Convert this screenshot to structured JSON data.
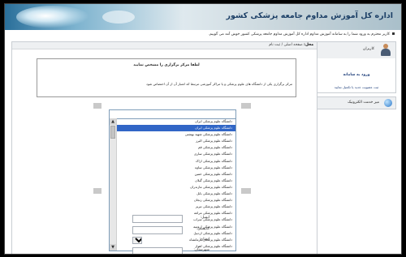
{
  "banner": {
    "title": "اداره کل آموزش مداوم جامعه پزشکی کشور"
  },
  "welcome": {
    "text": "کاربر محترم به ورود شما را به سامانه آموزش مداوم اداره کل آموزش مداوم جامعه پزشکی کشور خوش آمد می گوییم."
  },
  "page": {
    "label": "محل:",
    "path": "صفحه اصلی / ثبت نام"
  },
  "notice": {
    "title": "لطفا مرکز برگزاری را مشخص نمایید",
    "text": "مرکز برگزاری یکی از دانشگاه های علوم پزشکی و یا مراکز آموزشی مرتبط که اعتبار آن از آن اختصاص شود"
  },
  "dropdown": {
    "selected": "",
    "highlighted_index": 1,
    "options": [
      "دانشگاه علوم پزشکی ایران",
      "دانشگاه علوم پزشکی ایران",
      "دانشگاه علوم پزشکی شهید بهشتی",
      "دانشگاه علوم پزشکی البرز",
      "دانشگاه علوم پزشکی قم",
      "دانشگاه علوم پزشکی ساری",
      "دانشگاه علوم پزشکی اراک",
      "دانشگاه علوم پزشکی ساوه",
      "دانشگاه علوم پزشکی خمین",
      "دانشگاه علوم پزشکی گیلان",
      "دانشگاه علوم پزشکی مازندران",
      "دانشگاه علوم پزشکی بابل",
      "دانشگاه علوم پزشکی زنجان",
      "دانشگاه علوم پزشکی تبریز",
      "دانشگاه علوم پزشکی مراغه",
      "دانشگاه علوم پزشکی سراب",
      "دانشگاه علوم پزشکی ارومیه",
      "دانشگاه علوم پزشکی اردبیل",
      "دانشگاه علوم پزشکی کرمانشاه",
      "دانشگاه علوم پزشکی اهواز"
    ]
  },
  "form": {
    "email_label": "ایمیل:",
    "postal_label": "کدپستی:",
    "province_label": "استان:",
    "city_label": "شهرستان:"
  },
  "sidebar": {
    "user_title": "کاربران",
    "login_link": "ورود به سامانه",
    "register_link": "ثبت عضویت جدید یا تکمیل نمایید",
    "portal_title": "میز خدمت الکترونیک"
  }
}
